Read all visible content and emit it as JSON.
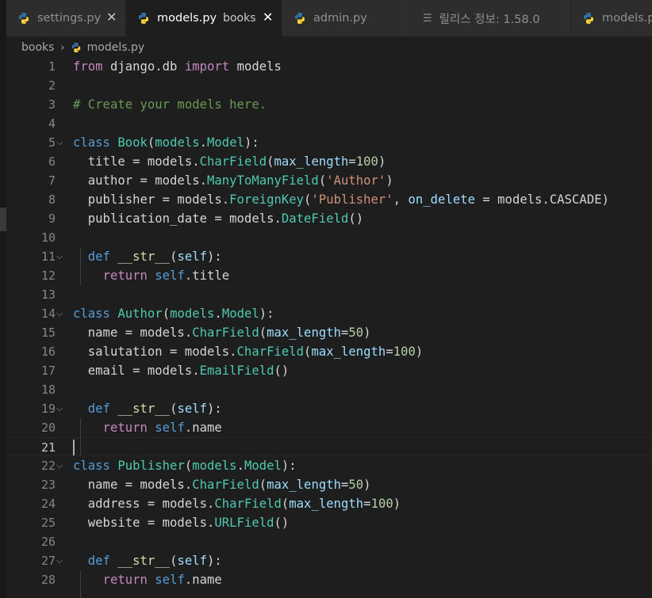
{
  "tabs": [
    {
      "label": "settings.py",
      "icon": "python-icon",
      "close": "✕",
      "active": false
    },
    {
      "label": "models.py",
      "description": "books",
      "icon": "python-icon",
      "close": "✕",
      "active": true
    },
    {
      "label": "admin.py",
      "icon": "python-icon",
      "active": false
    },
    {
      "label": "릴리스 정보: 1.58.0",
      "icon": "lines-icon",
      "active": false
    },
    {
      "label": "models.p",
      "icon": "python-icon",
      "active": false
    }
  ],
  "breadcrumb": {
    "folder": "books",
    "separator": "›",
    "file": "models.py"
  },
  "colors": {
    "keyword": "#569cd6",
    "control": "#c586c0",
    "class": "#4ec9b0",
    "function": "#dcdcaa",
    "string": "#ce9178",
    "number": "#b5cea8",
    "parameter": "#9cdcfe",
    "comment": "#6a9955",
    "text": "#d4d4d4",
    "python_blue": "#3572a5",
    "python_yellow": "#ffd43b"
  },
  "editor": {
    "current_line": 21,
    "lines": [
      {
        "n": "1",
        "tokens": [
          [
            "from",
            "ctl"
          ],
          [
            " django.db ",
            "txt"
          ],
          [
            "import",
            "ctl"
          ],
          [
            " models",
            "txt"
          ]
        ]
      },
      {
        "n": "2",
        "tokens": []
      },
      {
        "n": "3",
        "tokens": [
          [
            "# Create your models here.",
            "cmt"
          ]
        ]
      },
      {
        "n": "4",
        "tokens": []
      },
      {
        "n": "5",
        "fold": "⌵",
        "tokens": [
          [
            "class",
            "kw"
          ],
          [
            " ",
            "txt"
          ],
          [
            "Book",
            "cls"
          ],
          [
            "(",
            "txt"
          ],
          [
            "models",
            "cls"
          ],
          [
            ".",
            "txt"
          ],
          [
            "Model",
            "cls"
          ],
          [
            "):",
            "txt"
          ]
        ]
      },
      {
        "n": "6",
        "tokens": [
          [
            "  title = models.",
            "txt"
          ],
          [
            "CharField",
            "cls"
          ],
          [
            "(",
            "txt"
          ],
          [
            "max_length",
            "prm"
          ],
          [
            "=",
            "txt"
          ],
          [
            "100",
            "num"
          ],
          [
            ")",
            "txt"
          ]
        ]
      },
      {
        "n": "7",
        "tokens": [
          [
            "  author = models.",
            "txt"
          ],
          [
            "ManyToManyField",
            "cls"
          ],
          [
            "(",
            "txt"
          ],
          [
            "'Author'",
            "str"
          ],
          [
            ")",
            "txt"
          ]
        ]
      },
      {
        "n": "8",
        "tokens": [
          [
            "  publisher = models.",
            "txt"
          ],
          [
            "ForeignKey",
            "cls"
          ],
          [
            "(",
            "txt"
          ],
          [
            "'Publisher'",
            "str"
          ],
          [
            ", ",
            "txt"
          ],
          [
            "on_delete",
            "prm"
          ],
          [
            " = models.CASCADE)",
            "txt"
          ]
        ]
      },
      {
        "n": "9",
        "tokens": [
          [
            "  publication_date = models.",
            "txt"
          ],
          [
            "DateField",
            "cls"
          ],
          [
            "()",
            "txt"
          ]
        ]
      },
      {
        "n": "10",
        "tokens": []
      },
      {
        "n": "11",
        "fold": "⌵",
        "tokens": [
          [
            "  ",
            "txt"
          ],
          [
            "def",
            "kw"
          ],
          [
            " ",
            "txt"
          ],
          [
            "__str__",
            "fn"
          ],
          [
            "(",
            "txt"
          ],
          [
            "self",
            "prm"
          ],
          [
            "):",
            "txt"
          ]
        ]
      },
      {
        "n": "12",
        "tokens": [
          [
            "    ",
            "txt"
          ],
          [
            "return",
            "ctl"
          ],
          [
            " ",
            "txt"
          ],
          [
            "self",
            "kw"
          ],
          [
            ".title",
            "txt"
          ]
        ]
      },
      {
        "n": "13",
        "tokens": []
      },
      {
        "n": "14",
        "fold": "⌵",
        "tokens": [
          [
            "class",
            "kw"
          ],
          [
            " ",
            "txt"
          ],
          [
            "Author",
            "cls"
          ],
          [
            "(",
            "txt"
          ],
          [
            "models",
            "cls"
          ],
          [
            ".",
            "txt"
          ],
          [
            "Model",
            "cls"
          ],
          [
            "):",
            "txt"
          ]
        ]
      },
      {
        "n": "15",
        "tokens": [
          [
            "  name = models.",
            "txt"
          ],
          [
            "CharField",
            "cls"
          ],
          [
            "(",
            "txt"
          ],
          [
            "max_length",
            "prm"
          ],
          [
            "=",
            "txt"
          ],
          [
            "50",
            "num"
          ],
          [
            ")",
            "txt"
          ]
        ]
      },
      {
        "n": "16",
        "tokens": [
          [
            "  salutation = models.",
            "txt"
          ],
          [
            "CharField",
            "cls"
          ],
          [
            "(",
            "txt"
          ],
          [
            "max_length",
            "prm"
          ],
          [
            "=",
            "txt"
          ],
          [
            "100",
            "num"
          ],
          [
            ")",
            "txt"
          ]
        ]
      },
      {
        "n": "17",
        "tokens": [
          [
            "  email = models.",
            "txt"
          ],
          [
            "EmailField",
            "cls"
          ],
          [
            "()",
            "txt"
          ]
        ]
      },
      {
        "n": "18",
        "tokens": []
      },
      {
        "n": "19",
        "fold": "⌵",
        "tokens": [
          [
            "  ",
            "txt"
          ],
          [
            "def",
            "kw"
          ],
          [
            " ",
            "txt"
          ],
          [
            "__str__",
            "fn"
          ],
          [
            "(",
            "txt"
          ],
          [
            "self",
            "prm"
          ],
          [
            "):",
            "txt"
          ]
        ]
      },
      {
        "n": "20",
        "tokens": [
          [
            "    ",
            "txt"
          ],
          [
            "return",
            "ctl"
          ],
          [
            " ",
            "txt"
          ],
          [
            "self",
            "kw"
          ],
          [
            ".name",
            "txt"
          ]
        ]
      },
      {
        "n": "21",
        "tokens": []
      },
      {
        "n": "22",
        "fold": "⌵",
        "tokens": [
          [
            "class",
            "kw"
          ],
          [
            " ",
            "txt"
          ],
          [
            "Publisher",
            "cls"
          ],
          [
            "(",
            "txt"
          ],
          [
            "models",
            "cls"
          ],
          [
            ".",
            "txt"
          ],
          [
            "Model",
            "cls"
          ],
          [
            "):",
            "txt"
          ]
        ]
      },
      {
        "n": "23",
        "tokens": [
          [
            "  name = models.",
            "txt"
          ],
          [
            "CharField",
            "cls"
          ],
          [
            "(",
            "txt"
          ],
          [
            "max_length",
            "prm"
          ],
          [
            "=",
            "txt"
          ],
          [
            "50",
            "num"
          ],
          [
            ")",
            "txt"
          ]
        ]
      },
      {
        "n": "24",
        "tokens": [
          [
            "  address = models.",
            "txt"
          ],
          [
            "CharField",
            "cls"
          ],
          [
            "(",
            "txt"
          ],
          [
            "max_length",
            "prm"
          ],
          [
            "=",
            "txt"
          ],
          [
            "100",
            "num"
          ],
          [
            ")",
            "txt"
          ]
        ]
      },
      {
        "n": "25",
        "tokens": [
          [
            "  website = models.",
            "txt"
          ],
          [
            "URLField",
            "cls"
          ],
          [
            "()",
            "txt"
          ]
        ]
      },
      {
        "n": "26",
        "tokens": []
      },
      {
        "n": "27",
        "fold": "⌵",
        "tokens": [
          [
            "  ",
            "txt"
          ],
          [
            "def",
            "kw"
          ],
          [
            " ",
            "txt"
          ],
          [
            "__str__",
            "fn"
          ],
          [
            "(",
            "txt"
          ],
          [
            "self",
            "prm"
          ],
          [
            "):",
            "txt"
          ]
        ]
      },
      {
        "n": "28",
        "tokens": [
          [
            "    ",
            "txt"
          ],
          [
            "return",
            "ctl"
          ],
          [
            " ",
            "txt"
          ],
          [
            "self",
            "kw"
          ],
          [
            ".name",
            "txt"
          ]
        ]
      }
    ]
  }
}
